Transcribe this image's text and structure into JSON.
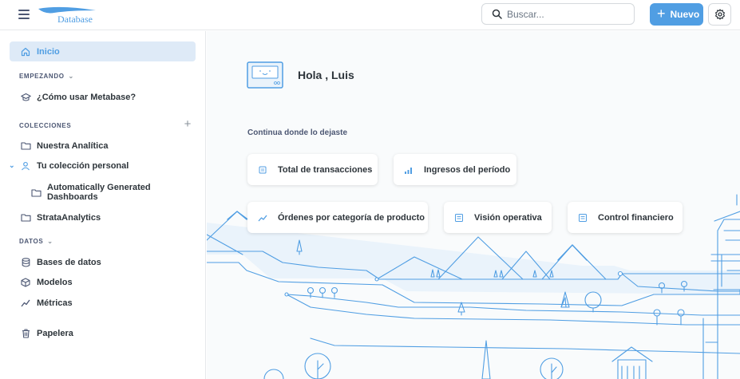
{
  "header": {
    "logo_text": "Database",
    "search_placeholder": "Buscar...",
    "new_button": "Nuevo"
  },
  "sidebar": {
    "home": "Inicio",
    "start_section": "EMPEZANDO",
    "how_to": "¿Cómo usar Metabase?",
    "collections_section": "COLECCIONES",
    "collections": [
      "Nuestra Analítica",
      "Tu colección personal",
      "Automatically Generated Dashboards",
      "StrataAnalytics"
    ],
    "data_section": "DATOS",
    "data_items": [
      "Bases de datos",
      "Modelos",
      "Métricas"
    ],
    "trash": "Papelera"
  },
  "main": {
    "greeting": "Hola , Luis",
    "continue_label": "Continua donde lo dejaste",
    "cards": [
      "Total de transacciones",
      "Ingresos del período",
      "Órdenes por categoría de producto",
      "Visión operativa",
      "Control financiero"
    ]
  },
  "colors": {
    "brand": "#509ee3",
    "active_bg": "#deeaf7",
    "text": "#2e353b"
  }
}
